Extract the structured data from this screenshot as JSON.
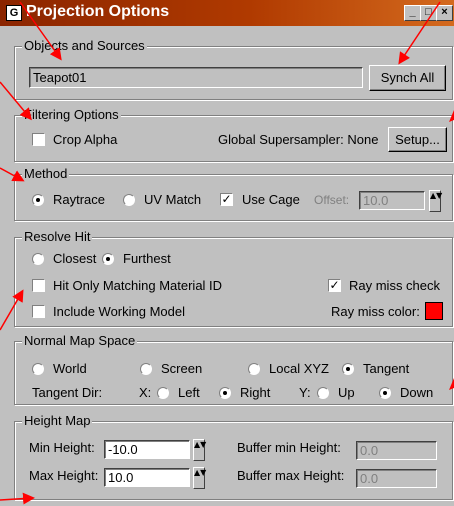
{
  "window": {
    "title": "Projection Options",
    "min_glyph": "_",
    "max_glyph": "□",
    "close_glyph": "×"
  },
  "objects": {
    "legend": "Objects and Sources",
    "value": "Teapot01",
    "synch_label": "Synch All"
  },
  "filtering": {
    "legend": "Filtering Options",
    "crop_alpha_label": "Crop Alpha",
    "crop_alpha_checked": false,
    "supersampler_text": "Global Supersampler: None",
    "setup_label": "Setup..."
  },
  "method": {
    "legend": "Method",
    "raytrace_label": "Raytrace",
    "uvmatch_label": "UV Match",
    "usecage_label": "Use Cage",
    "usecage_checked": true,
    "offset_label": "Offset:",
    "offset_value": "10.0"
  },
  "resolve": {
    "legend": "Resolve Hit",
    "closest_label": "Closest",
    "furthest_label": "Furthest",
    "hit_only_label": "Hit Only Matching Material ID",
    "ray_miss_check_label": "Ray miss check",
    "include_working_label": "Include Working Model",
    "ray_miss_color_label": "Ray miss color:",
    "ray_miss_color": "#ff0000"
  },
  "normal": {
    "legend": "Normal Map Space",
    "world_label": "World",
    "screen_label": "Screen",
    "localxyz_label": "Local XYZ",
    "tangent_label": "Tangent",
    "tangent_dir_label": "Tangent Dir:",
    "x_label": "X:",
    "left_label": "Left",
    "right_label": "Right",
    "y_label": "Y:",
    "up_label": "Up",
    "down_label": "Down"
  },
  "height": {
    "legend": "Height Map",
    "min_label": "Min Height:",
    "min_value": "-10.0",
    "max_label": "Max Height:",
    "max_value": "10.0",
    "buffer_min_label": "Buffer min Height:",
    "buffer_min_value": "0.0",
    "buffer_max_label": "Buffer max Height:",
    "buffer_max_value": "0.0"
  },
  "check_glyph": "✓",
  "spinner_glyph": "▲▼",
  "arrow_color": "#ff0000"
}
